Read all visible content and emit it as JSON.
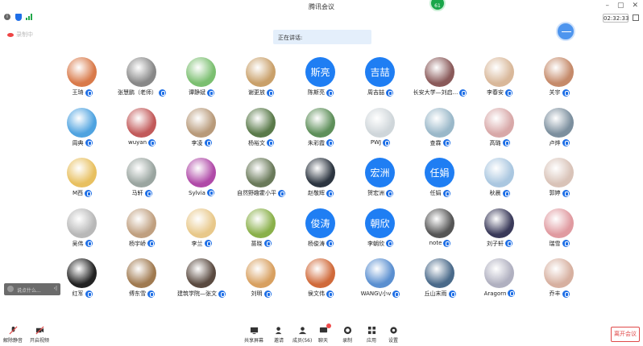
{
  "window": {
    "title": "腾讯会议",
    "notification_count": "61",
    "controls": [
      "–",
      "▢",
      "✕"
    ]
  },
  "status": {
    "timer": "02:32:33"
  },
  "recording": {
    "label": "录制中"
  },
  "speaking": {
    "label": "正在讲话:"
  },
  "colors": {
    "accent": "#1f7ef3",
    "leave": "#e04a4a",
    "notif": "#1aa64a"
  },
  "participants": [
    {
      "name": "王琦",
      "avatar": "img",
      "color": "#d97a4a"
    },
    {
      "name": "张慧鹏（老师）",
      "avatar": "img",
      "color": "#888888"
    },
    {
      "name": "谭静斌",
      "avatar": "img",
      "color": "#7bbf70"
    },
    {
      "name": "谢更放",
      "avatar": "img",
      "color": "#c9a06a"
    },
    {
      "name": "陈斯亮",
      "avatar": "text",
      "text": "斯亮"
    },
    {
      "name": "周吉喆",
      "avatar": "text",
      "text": "吉喆"
    },
    {
      "name": "长安大学—刘启...",
      "avatar": "img",
      "color": "#8a5a5a"
    },
    {
      "name": "李春安",
      "avatar": "img",
      "color": "#d9b89a"
    },
    {
      "name": "关宇",
      "avatar": "img",
      "color": "#c58a6a"
    },
    {
      "name": "周典",
      "avatar": "img",
      "color": "#4fa3e0"
    },
    {
      "name": "wuyan",
      "avatar": "img",
      "color": "#c25a5a"
    },
    {
      "name": "李凌",
      "avatar": "img",
      "color": "#b89a7a"
    },
    {
      "name": "杨裕文",
      "avatar": "img",
      "color": "#5a7a4a"
    },
    {
      "name": "朱彩霞",
      "avatar": "img",
      "color": "#5e8f5a"
    },
    {
      "name": "PWJ",
      "avatar": "img",
      "color": "#cfd6da"
    },
    {
      "name": "查霖",
      "avatar": "img",
      "color": "#9ab8c9"
    },
    {
      "name": "高璐",
      "avatar": "img",
      "color": "#d8a8a8"
    },
    {
      "name": "卢烨",
      "avatar": "img",
      "color": "#7c8f9e"
    },
    {
      "name": "M西",
      "avatar": "img",
      "color": "#e8c060"
    },
    {
      "name": "马轩",
      "avatar": "img",
      "color": "#9aa5a0"
    },
    {
      "name": "Sylvia",
      "avatar": "img",
      "color": "#b04aa8"
    },
    {
      "name": "自然野趣霍小平",
      "avatar": "img",
      "color": "#6a7a5a"
    },
    {
      "name": "赵敬辉",
      "avatar": "img",
      "color": "#2c3540"
    },
    {
      "name": "贺宏洲",
      "avatar": "text",
      "text": "宏洲"
    },
    {
      "name": "任娟",
      "avatar": "text",
      "text": "任娟"
    },
    {
      "name": "秋晨",
      "avatar": "img",
      "color": "#aac7e0"
    },
    {
      "name": "郭婷",
      "avatar": "img",
      "color": "#d9c3b8"
    },
    {
      "name": "吴伟",
      "avatar": "img",
      "color": "#b8b8b8"
    },
    {
      "name": "杨宇峤",
      "avatar": "img",
      "color": "#c0a080"
    },
    {
      "name": "李兰",
      "avatar": "img",
      "color": "#e8c88a"
    },
    {
      "name": "蔷晓",
      "avatar": "img",
      "color": "#8ab04a"
    },
    {
      "name": "杨俊涛",
      "avatar": "text",
      "text": "俊涛"
    },
    {
      "name": "李朝欣",
      "avatar": "text",
      "text": "朝欣"
    },
    {
      "name": "note",
      "avatar": "img",
      "color": "#555555"
    },
    {
      "name": "刘子轩",
      "avatar": "img",
      "color": "#3a3a5a"
    },
    {
      "name": "瑞雪",
      "avatar": "img",
      "color": "#e09aa0"
    },
    {
      "name": "红军",
      "avatar": "img",
      "color": "#222222"
    },
    {
      "name": "傅东雪",
      "avatar": "img",
      "color": "#a07a50"
    },
    {
      "name": "建筑学院—张文",
      "avatar": "img",
      "color": "#5a4a40"
    },
    {
      "name": "刘明",
      "avatar": "img",
      "color": "#d8a060"
    },
    {
      "name": "侯文伟",
      "avatar": "img",
      "color": "#d06a3a"
    },
    {
      "name": "WANG\\/小v",
      "avatar": "img",
      "color": "#5a8fd0"
    },
    {
      "name": "丘山末雨",
      "avatar": "img",
      "color": "#4a6a8a"
    },
    {
      "name": "Aragorn",
      "avatar": "img",
      "color": "#b0b0c0"
    },
    {
      "name": "乔丰",
      "avatar": "img",
      "color": "#d7b0a0"
    }
  ],
  "chat": {
    "placeholder": "说点什么...",
    "send": "‹|"
  },
  "toolbar": {
    "mute": "解除静音",
    "video": "开启视频",
    "share": "共享屏幕",
    "invite": "邀请",
    "members": "成员(56)",
    "chat": "聊天",
    "record": "录制",
    "apps": "应用",
    "settings": "设置",
    "leave": "离开会议"
  }
}
